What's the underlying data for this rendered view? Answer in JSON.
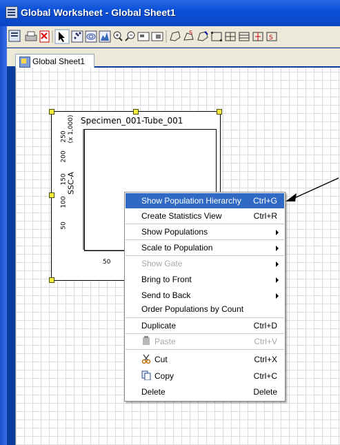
{
  "window": {
    "title": "Global Worksheet - Global Sheet1"
  },
  "toolbar": {
    "buttons": [
      "worksheet-icon",
      "print-icon",
      "pdf-icon",
      "pointer-icon",
      "dot-plot-icon",
      "contour-plot-icon",
      "histogram-icon",
      "zoom-in-icon",
      "zoom-out-icon",
      "layout-icon",
      "snap-icon",
      "polygon-gate-icon",
      "snap-gate-icon",
      "autogate-icon",
      "rectangle-gate-icon",
      "quad-gate-icon",
      "interval-gate-icon",
      "grid-gate-icon"
    ]
  },
  "tab": {
    "label": "Global Sheet1"
  },
  "plot": {
    "title": "Specimen_001-Tube_001",
    "ylabel": "SSC-A",
    "yscale": "(x 1,000)",
    "yticks": [
      "250",
      "200",
      "150",
      "100",
      "50"
    ],
    "xticks": [
      "50"
    ]
  },
  "context_menu": {
    "items": [
      {
        "label": "Show Population Hierarchy",
        "shortcut": "Ctrl+G",
        "state": "selected"
      },
      {
        "label": "Create Statistics View",
        "shortcut": "Ctrl+R"
      },
      {
        "label": "Show Populations",
        "submenu": true
      },
      {
        "label": "Scale to Population",
        "submenu": true
      },
      {
        "label": "Show Gate",
        "submenu": true,
        "state": "disabled"
      },
      {
        "label": "Bring to Front",
        "submenu": true
      },
      {
        "label": "Send to Back",
        "submenu": true
      },
      {
        "label": "Order Populations by Count"
      },
      {
        "label": "Duplicate",
        "shortcut": "Ctrl+D"
      },
      {
        "label": "Paste",
        "shortcut": "Ctrl+V",
        "icon": "paste-icon",
        "state": "disabled"
      },
      {
        "label": "Cut",
        "shortcut": "Ctrl+X",
        "icon": "scissors-icon"
      },
      {
        "label": "Copy",
        "shortcut": "Ctrl+C",
        "icon": "copy-icon"
      },
      {
        "label": "Delete",
        "shortcut": "Delete"
      }
    ]
  },
  "colors": {
    "titlebar": "#0a4fd6",
    "selection": "#316ac5",
    "handle": "#ffef3d"
  }
}
